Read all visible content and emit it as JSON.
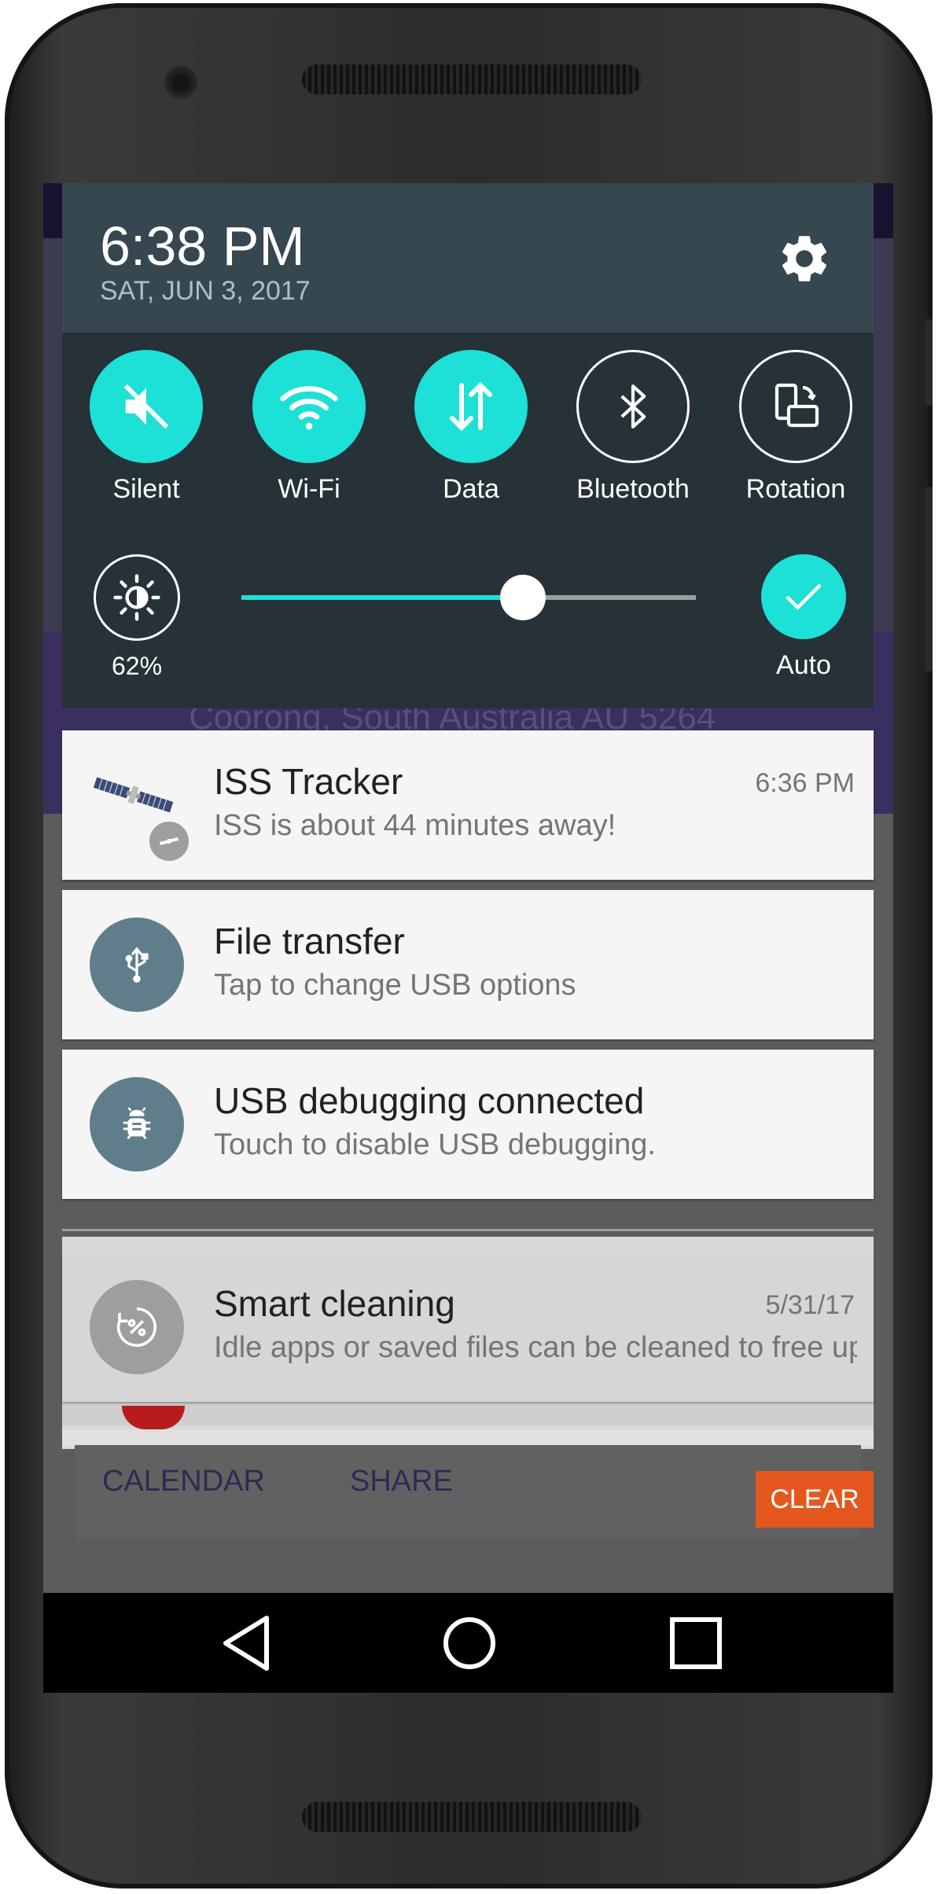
{
  "status_header": {
    "time": "6:38 PM",
    "date": "SAT, JUN 3, 2017"
  },
  "quick_settings": {
    "tiles": [
      {
        "label": "Silent",
        "icon": "mute-icon",
        "state": "on"
      },
      {
        "label": "Wi-Fi",
        "icon": "wifi-icon",
        "state": "on"
      },
      {
        "label": "Data",
        "icon": "data-icon",
        "state": "on"
      },
      {
        "label": "Bluetooth",
        "icon": "bluetooth-icon",
        "state": "off"
      },
      {
        "label": "Rotation",
        "icon": "rotation-icon",
        "state": "off"
      }
    ],
    "brightness": {
      "percent_label": "62%",
      "level": 0.62,
      "auto_label": "Auto",
      "auto": true
    }
  },
  "background_app": {
    "address": "Coorong, South Australia AU 5264"
  },
  "notifications": [
    {
      "app": "ISS Tracker",
      "text": "ISS is about 44 minutes away!",
      "time": "6:36 PM",
      "icon": "satellite-icon"
    },
    {
      "app": "File transfer",
      "text": "Tap to change USB options",
      "time": "",
      "icon": "usb-icon"
    },
    {
      "app": "USB debugging connected",
      "text": "Touch to disable USB debugging.",
      "time": "",
      "icon": "android-debug-icon"
    },
    {
      "app": "Smart cleaning",
      "text": "Idle apps or saved files can be cleaned to free up space.",
      "time": "5/31/17",
      "icon": "cleaning-icon"
    }
  ],
  "actions": {
    "calendar": "CALENDAR",
    "share": "SHARE",
    "clear": "CLEAR"
  },
  "navigation": [
    "back-icon",
    "home-icon",
    "recents-icon"
  ],
  "colors": {
    "accent": "#1de0d7",
    "panel": "#263238",
    "panel_header": "#37474f",
    "clear_button": "#e4581f"
  }
}
